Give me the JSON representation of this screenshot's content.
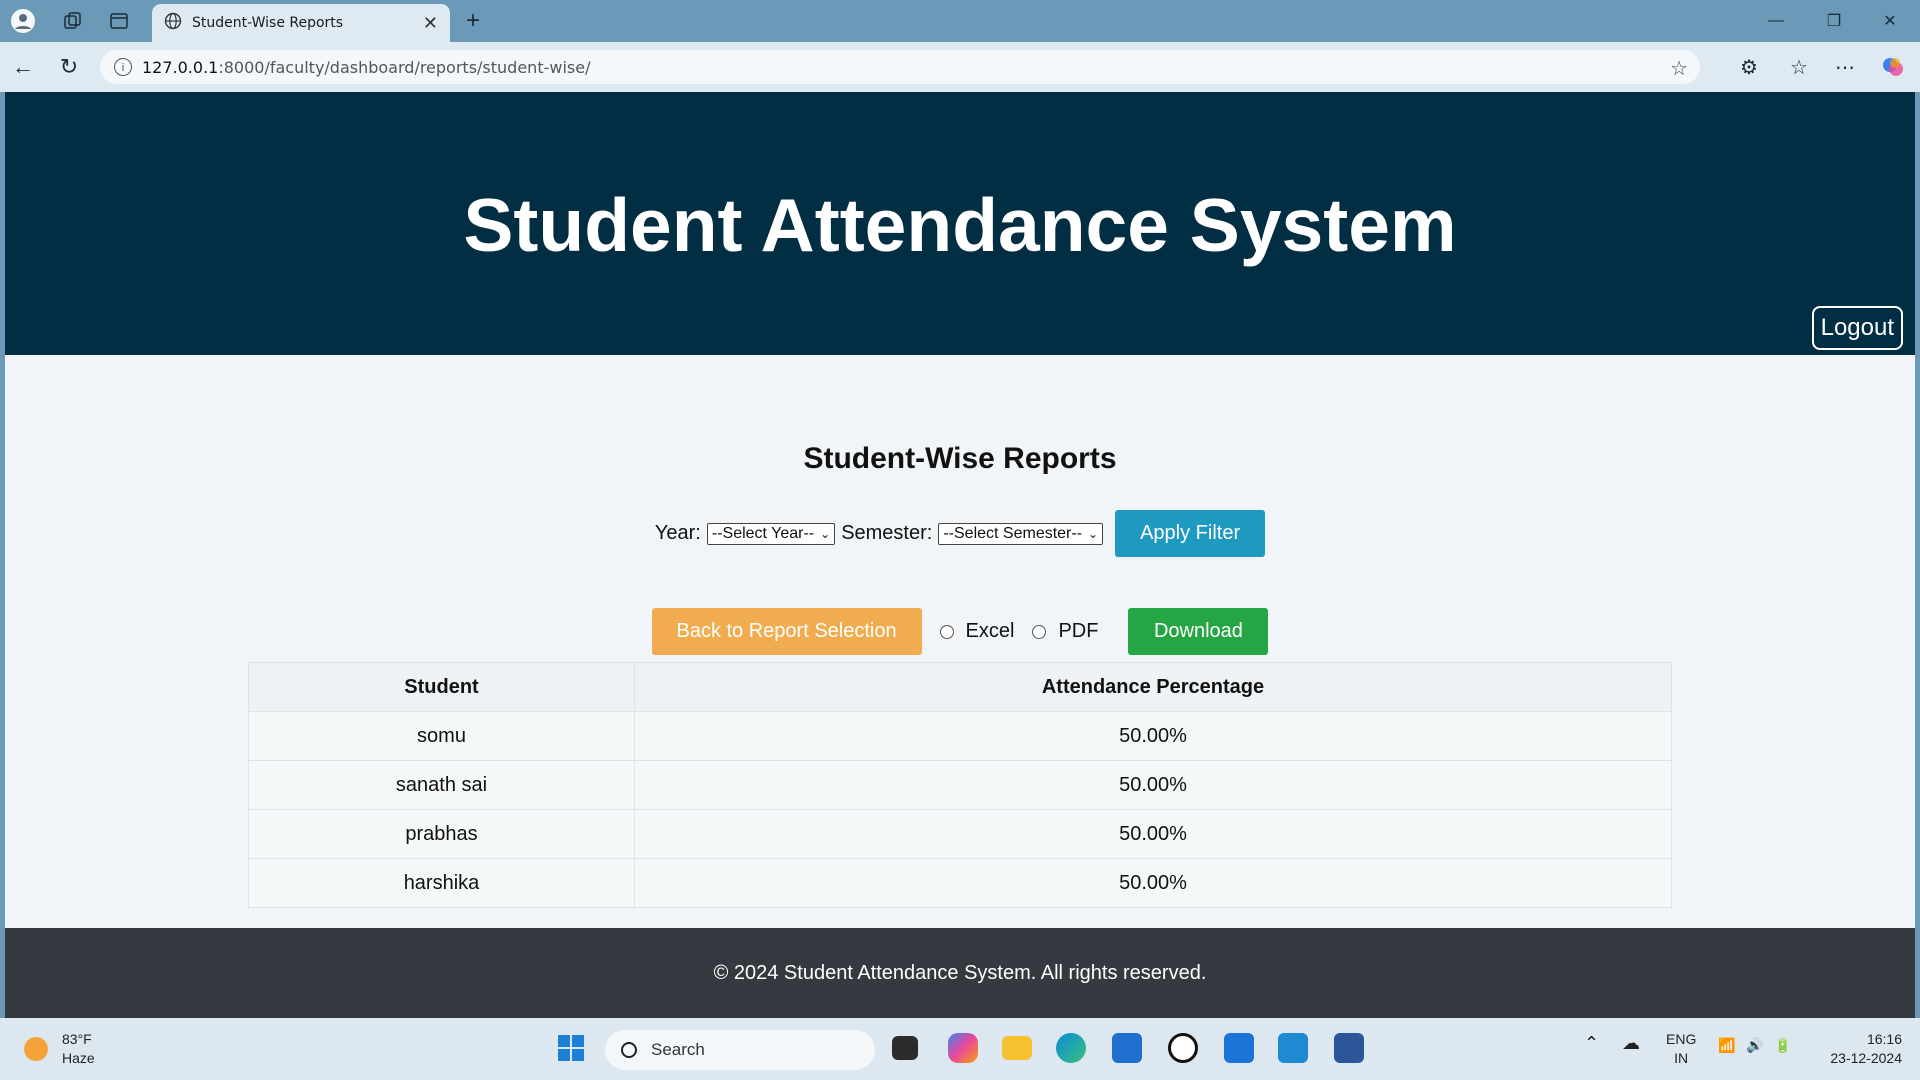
{
  "browser": {
    "tab_title": "Student-Wise Reports",
    "url_host": "127.0.0.1",
    "url_path": ":8000/faculty/dashboard/reports/student-wise/"
  },
  "header": {
    "site_title": "Student Attendance System",
    "logout_label": "Logout"
  },
  "page": {
    "heading": "Student-Wise Reports"
  },
  "filters": {
    "year_label": "Year:",
    "year_value": "--Select Year--",
    "semester_label": "Semester:",
    "semester_value": "--Select Semester--",
    "apply_label": "Apply Filter"
  },
  "actions": {
    "back_label": "Back to Report Selection",
    "excel_label": "Excel",
    "pdf_label": "PDF",
    "download_label": "Download"
  },
  "table": {
    "headers": [
      "Student",
      "Attendance Percentage"
    ],
    "rows": [
      [
        "somu",
        "50.00%"
      ],
      [
        "sanath sai",
        "50.00%"
      ],
      [
        "prabhas",
        "50.00%"
      ],
      [
        "harshika",
        "50.00%"
      ]
    ]
  },
  "footer": {
    "text": "© 2024 Student Attendance System. All rights reserved."
  },
  "taskbar": {
    "temperature": "83°F",
    "weather": "Haze",
    "search_placeholder": "Search",
    "lang_1": "ENG",
    "lang_2": "IN",
    "time": "16:16",
    "date": "23-12-2024"
  },
  "colors": {
    "header_bg": "#022e44",
    "apply_btn": "#1e9ac0",
    "back_btn": "#f0ac4e",
    "download_btn": "#25a644",
    "footer_bg": "#343a40"
  }
}
